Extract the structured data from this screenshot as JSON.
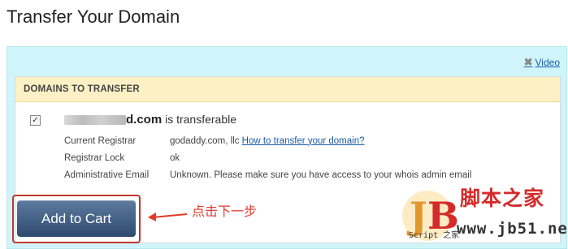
{
  "page": {
    "title": "Transfer Your Domain"
  },
  "video": {
    "label": "Video",
    "icon": "close-x-icon"
  },
  "transfer_box": {
    "header": "DOMAINS TO TRANSFER",
    "domain": {
      "visible_suffix": "d.com",
      "status_text": "is transferable",
      "checked": true
    },
    "details": [
      {
        "label": "Current Registrar",
        "value": "godaddy.com, llc",
        "link": "How to transfer your domain?"
      },
      {
        "label": "Registrar Lock",
        "value": "ok"
      },
      {
        "label": "Administrative Email",
        "value": "Unknown. Please make sure you have access to your whois admin email"
      }
    ]
  },
  "actions": {
    "add_to_cart_label": "Add to Cart"
  },
  "annotation": {
    "text": "点击下一步",
    "color": "#e03a2b"
  },
  "watermark": {
    "site_name": "脚本之家",
    "url": "www.jb51.net",
    "script_text": "Script 之家"
  }
}
